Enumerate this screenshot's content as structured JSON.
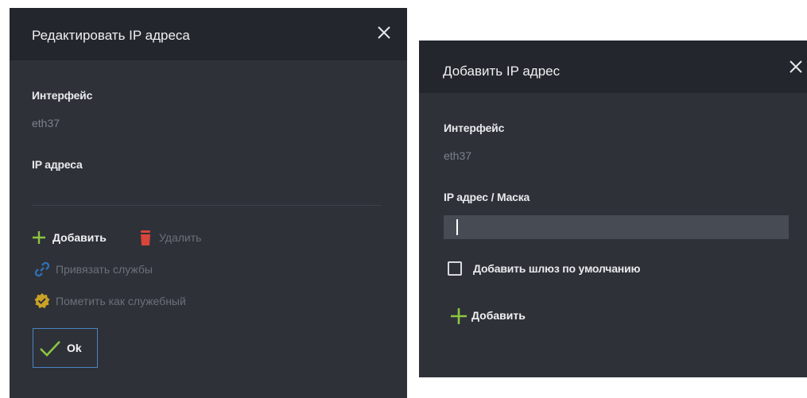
{
  "edit_dialog": {
    "title": "Редактировать IP адреса",
    "interface_label": "Интерфейс",
    "interface_value": "eth37",
    "ip_label": "IP адреса",
    "actions": {
      "add": "Добавить",
      "delete": "Удалить",
      "bind_services": "Привязать службы",
      "mark_service": "Пометить как служебный"
    },
    "ok_label": "Ok"
  },
  "add_dialog": {
    "title": "Добавить IP адрес",
    "interface_label": "Интерфейс",
    "interface_value": "eth37",
    "ip_mask_label": "IP адрес / Маска",
    "ip_mask_value": "",
    "default_gateway_label": "Добавить шлюз по умолчанию",
    "default_gateway_checked": false,
    "add_label": "Добавить"
  },
  "colors": {
    "dialog_bg": "#2e3138",
    "header_bg": "#23262c",
    "add_icon_green": "#8cc63f",
    "delete_icon_red": "#d9453b",
    "link_icon_blue": "#2f6fb3",
    "badge_icon_gold": "#c9a227",
    "ok_check_green": "#8cc63f",
    "ok_border_blue": "#4b83c3"
  }
}
